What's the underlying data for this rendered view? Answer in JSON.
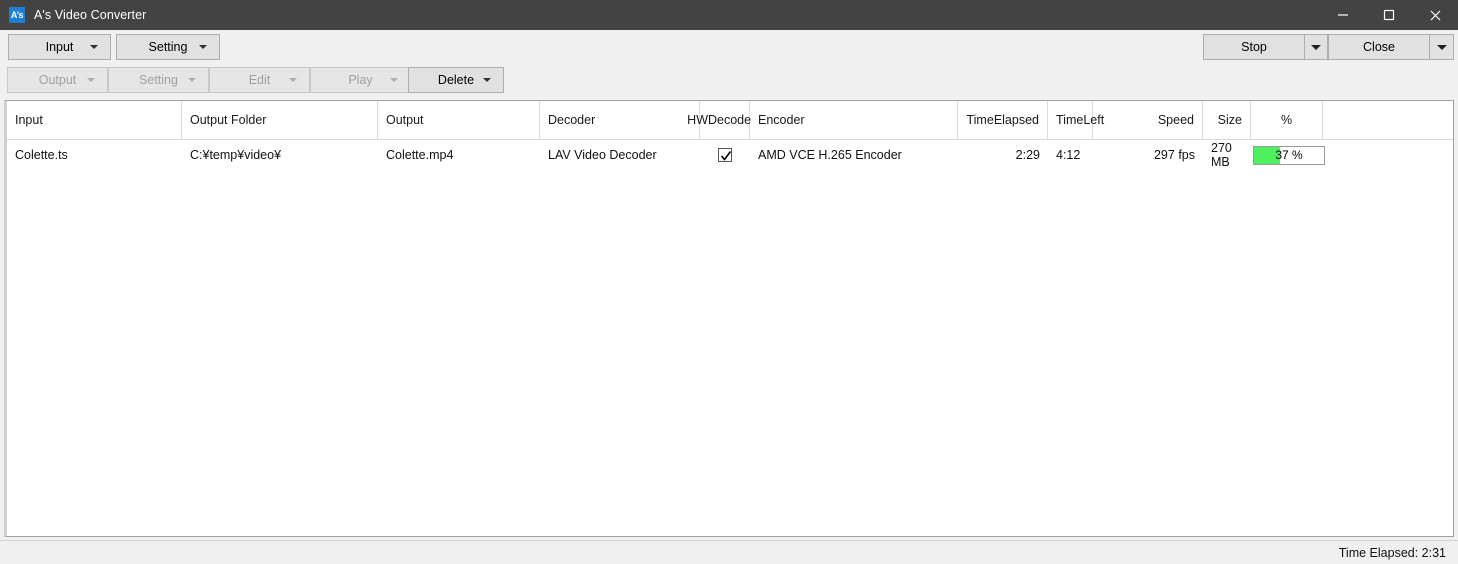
{
  "window": {
    "title": "A's Video Converter",
    "icon_label": "A's",
    "controls": {
      "minimize": "minimize-icon",
      "maximize": "maximize-icon",
      "close": "close-icon"
    }
  },
  "toolbar_primary": {
    "buttons": [
      {
        "label": "Input",
        "enabled": true,
        "has_dropdown": true
      },
      {
        "label": "Setting",
        "enabled": true,
        "has_dropdown": true
      }
    ],
    "right_buttons": [
      {
        "label": "Stop",
        "enabled": true,
        "has_dropdown": true
      },
      {
        "label": "Close",
        "enabled": true,
        "has_dropdown": true
      }
    ]
  },
  "toolbar_secondary": {
    "buttons": [
      {
        "label": "Output",
        "enabled": false,
        "has_dropdown": true
      },
      {
        "label": "Setting",
        "enabled": false,
        "has_dropdown": true
      },
      {
        "label": "Edit",
        "enabled": false,
        "has_dropdown": true
      },
      {
        "label": "Play",
        "enabled": false,
        "has_dropdown": true
      },
      {
        "label": "Delete",
        "enabled": true,
        "has_dropdown": true
      }
    ]
  },
  "list": {
    "columns": [
      {
        "key": "input",
        "label": "Input",
        "label_line2": "",
        "align": "left"
      },
      {
        "key": "output_folder",
        "label": "Output Folder",
        "label_line2": "",
        "align": "left"
      },
      {
        "key": "output",
        "label": "Output",
        "label_line2": "",
        "align": "left"
      },
      {
        "key": "decoder",
        "label": "Decoder",
        "label_line2": "",
        "align": "left"
      },
      {
        "key": "hw_decode",
        "label": "HW",
        "label_line2": "Decode",
        "align": "right"
      },
      {
        "key": "encoder",
        "label": "Encoder",
        "label_line2": "",
        "align": "left"
      },
      {
        "key": "time_elapsed",
        "label": "Time",
        "label_line2": "Elapsed",
        "align": "right"
      },
      {
        "key": "time_left",
        "label": "Time",
        "label_line2": "Left",
        "align": "left"
      },
      {
        "key": "speed",
        "label": "Speed",
        "label_line2": "",
        "align": "right"
      },
      {
        "key": "size",
        "label": "Size",
        "label_line2": "",
        "align": "right"
      },
      {
        "key": "percent",
        "label": "%",
        "label_line2": "",
        "align": "center"
      }
    ],
    "rows": [
      {
        "input": "Colette.ts",
        "output_folder": "C:¥temp¥video¥",
        "output": "Colette.mp4",
        "decoder": "LAV Video Decoder",
        "hw_decode": true,
        "encoder": "AMD VCE H.265 Encoder",
        "time_elapsed": "2:29",
        "time_left": "4:12",
        "speed": "297 fps",
        "size": "270 MB",
        "percent_value": 37,
        "percent_label": "37 %"
      }
    ]
  },
  "statusbar": {
    "text": "Time Elapsed: 2:31"
  },
  "colors": {
    "titlebar_bg": "#434343",
    "toolbar_bg": "#f0f0f0",
    "progress_fill": "#4ef060",
    "icon_bg": "#1e7fd4"
  }
}
